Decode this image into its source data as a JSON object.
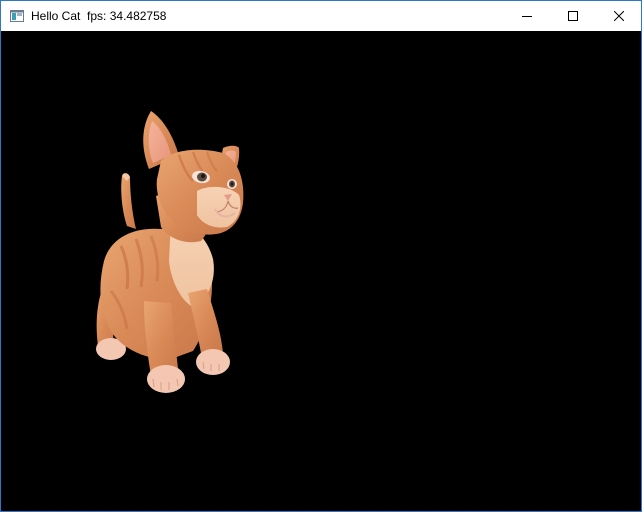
{
  "window": {
    "app_name": "Hello Cat",
    "fps_label": "fps:",
    "fps_value": "34.482758",
    "accent_border": "#2b78c9"
  },
  "controls": {
    "minimize_icon": "minimize-icon",
    "maximize_icon": "maximize-icon",
    "close_icon": "close-icon"
  },
  "viewport": {
    "background": "#000000",
    "subject": "kitten-3d-model"
  }
}
